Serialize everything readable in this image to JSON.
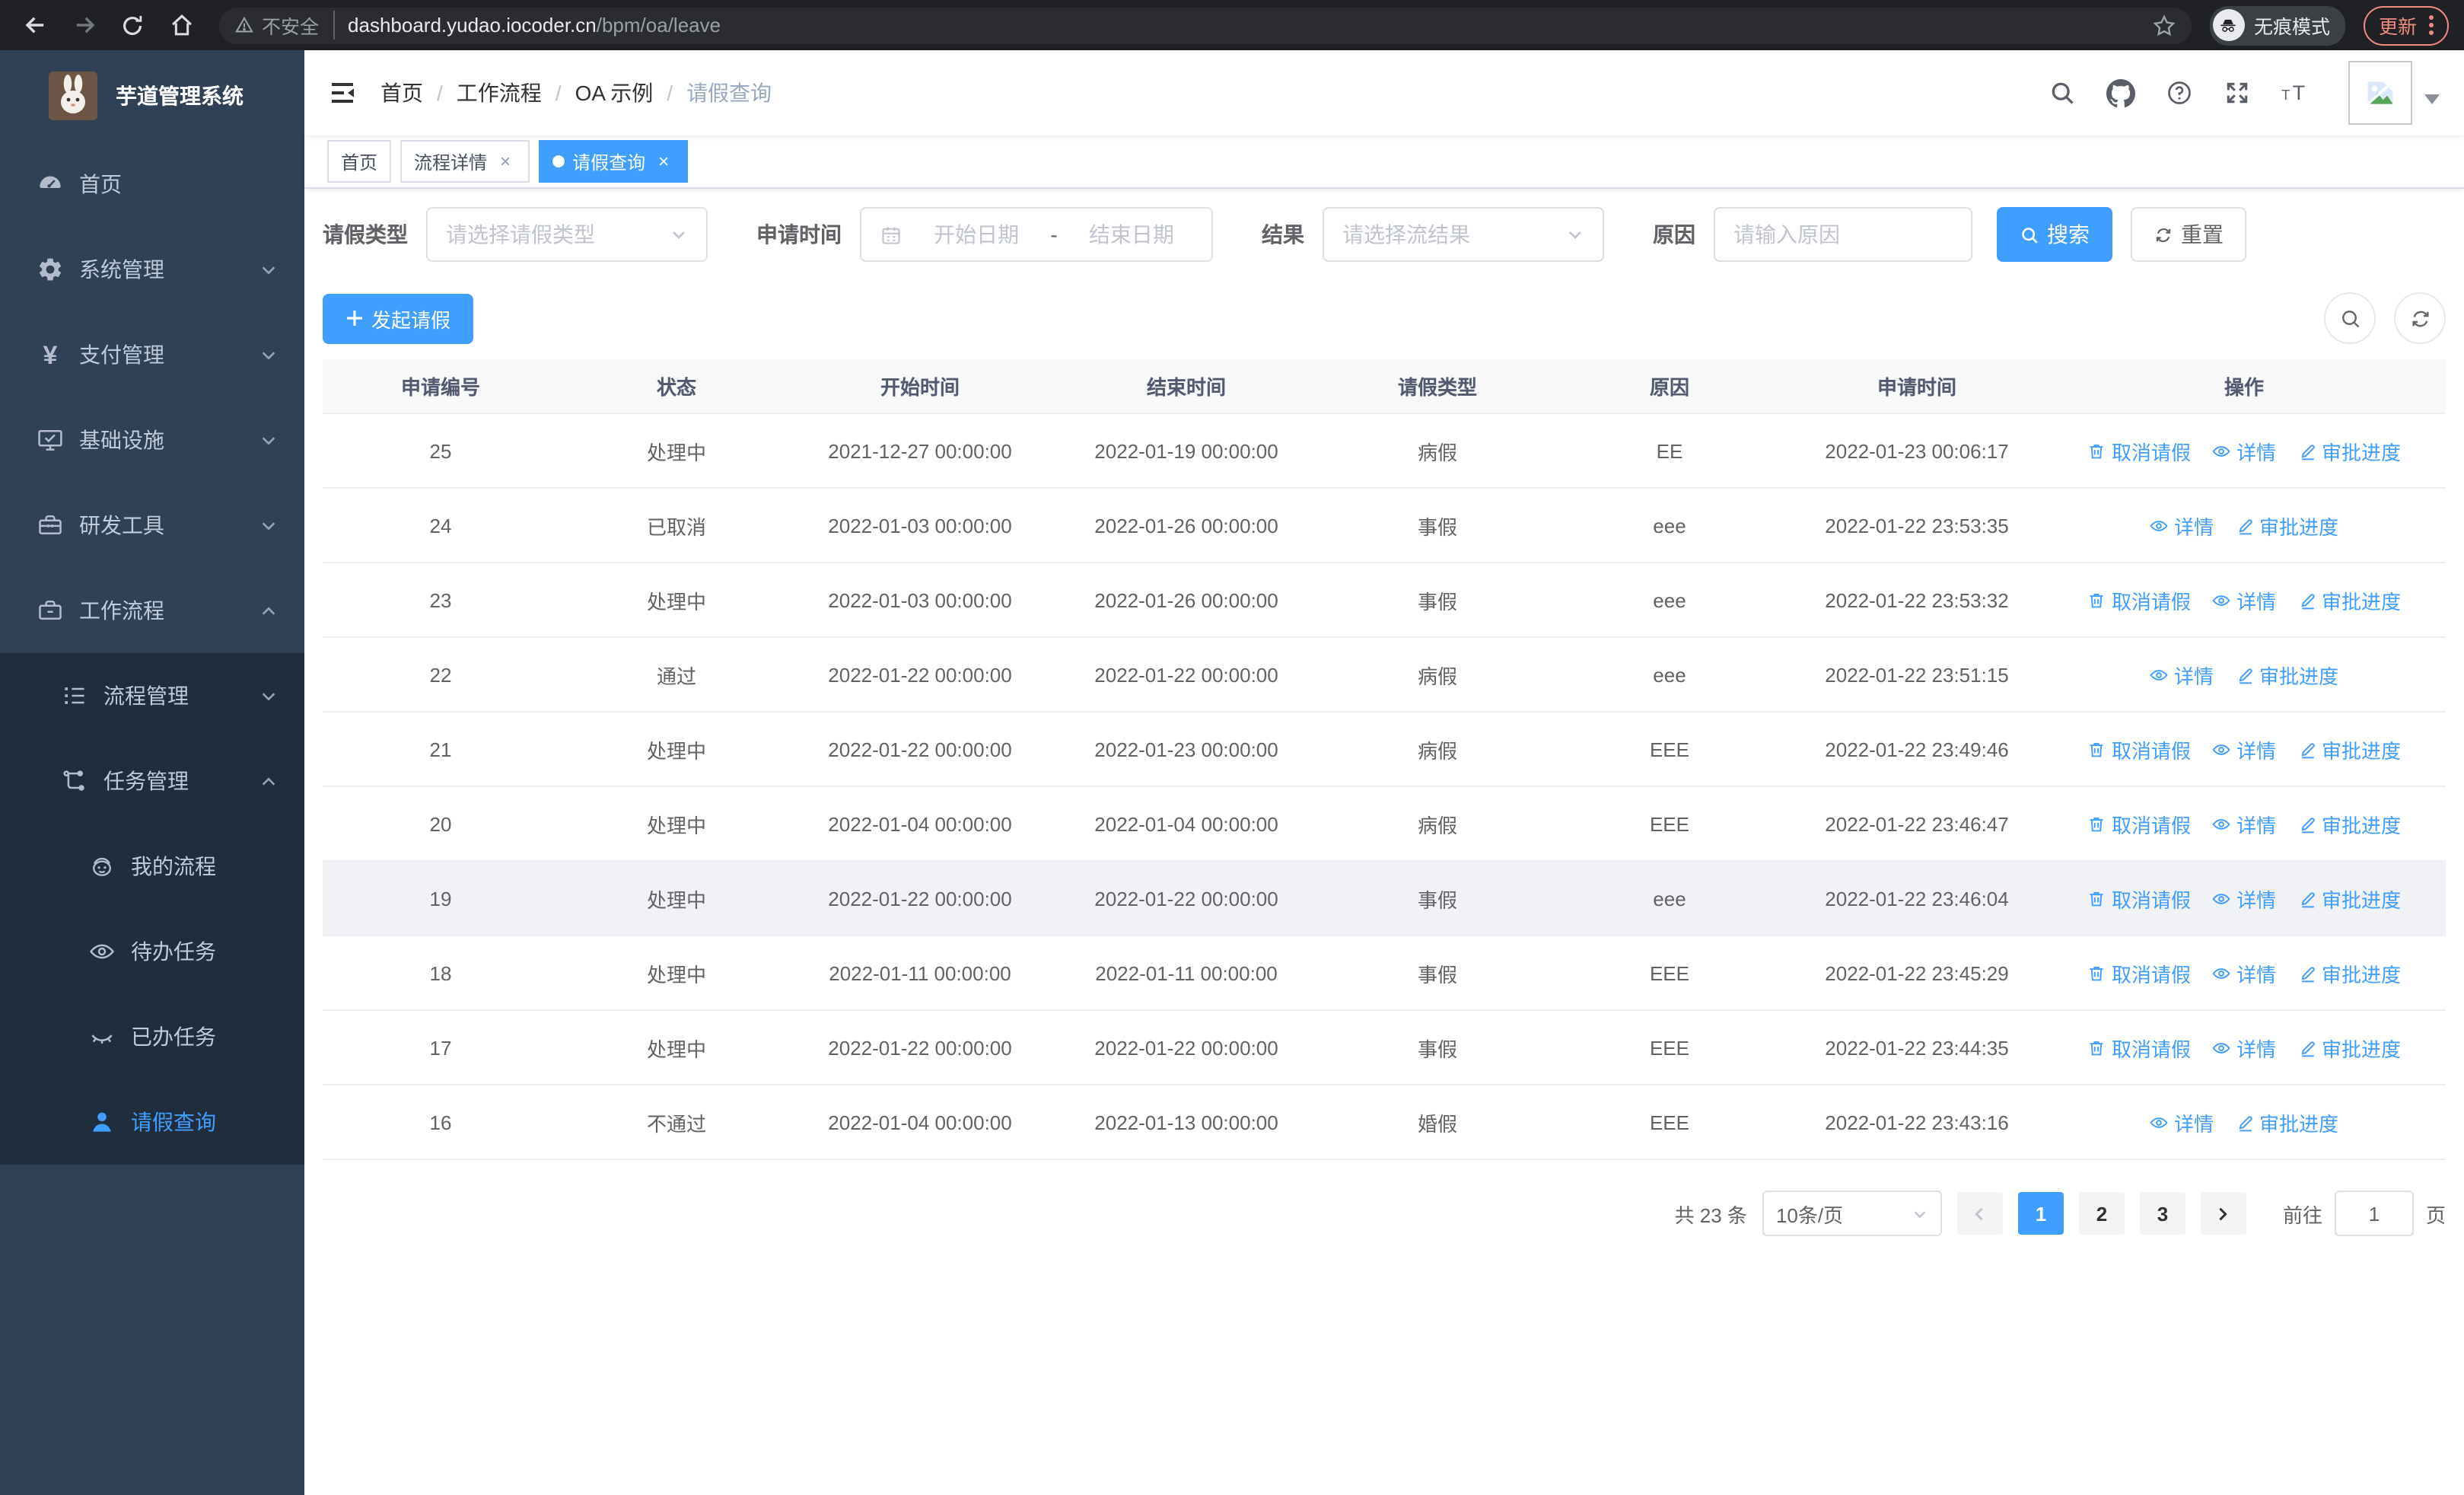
{
  "browser": {
    "security_label": "不安全",
    "url_domain": "dashboard.yudao.iocoder.cn",
    "url_path": "/bpm/oa/leave",
    "incognito_label": "无痕模式",
    "update_label": "更新"
  },
  "sidebar": {
    "title": "芋道管理系统",
    "menu": [
      {
        "label": "首页"
      },
      {
        "label": "系统管理"
      },
      {
        "label": "支付管理"
      },
      {
        "label": "基础设施"
      },
      {
        "label": "研发工具"
      },
      {
        "label": "工作流程"
      }
    ],
    "submenu": [
      {
        "label": "流程管理"
      },
      {
        "label": "任务管理"
      }
    ],
    "task_children": [
      {
        "label": "我的流程"
      },
      {
        "label": "待办任务"
      },
      {
        "label": "已办任务"
      },
      {
        "label": "请假查询"
      }
    ]
  },
  "navbar": {
    "breadcrumb": [
      "首页",
      "工作流程",
      "OA 示例",
      "请假查询"
    ]
  },
  "tags": [
    {
      "label": "首页"
    },
    {
      "label": "流程详情"
    },
    {
      "label": "请假查询"
    }
  ],
  "filters": {
    "type_label": "请假类型",
    "type_placeholder": "请选择请假类型",
    "time_label": "申请时间",
    "date_start_placeholder": "开始日期",
    "date_separator": "-",
    "date_end_placeholder": "结束日期",
    "result_label": "结果",
    "result_placeholder": "请选择流结果",
    "reason_label": "原因",
    "reason_placeholder": "请输入原因",
    "search_label": "搜索",
    "reset_label": "重置"
  },
  "toolbar": {
    "create_label": "发起请假"
  },
  "table": {
    "columns": [
      "申请编号",
      "状态",
      "开始时间",
      "结束时间",
      "请假类型",
      "原因",
      "申请时间",
      "操作"
    ],
    "action_labels": {
      "cancel": "取消请假",
      "detail": "详情",
      "progress": "审批进度"
    },
    "rows": [
      {
        "id": "25",
        "status": "处理中",
        "start": "2021-12-27 00:00:00",
        "end": "2022-01-19 00:00:00",
        "type": "病假",
        "reason": "EE",
        "applied": "2022-01-23 00:06:17",
        "actions": [
          "cancel",
          "detail",
          "progress"
        ],
        "highlight": false
      },
      {
        "id": "24",
        "status": "已取消",
        "start": "2022-01-03 00:00:00",
        "end": "2022-01-26 00:00:00",
        "type": "事假",
        "reason": "eee",
        "applied": "2022-01-22 23:53:35",
        "actions": [
          "detail",
          "progress"
        ],
        "highlight": false
      },
      {
        "id": "23",
        "status": "处理中",
        "start": "2022-01-03 00:00:00",
        "end": "2022-01-26 00:00:00",
        "type": "事假",
        "reason": "eee",
        "applied": "2022-01-22 23:53:32",
        "actions": [
          "cancel",
          "detail",
          "progress"
        ],
        "highlight": false
      },
      {
        "id": "22",
        "status": "通过",
        "start": "2022-01-22 00:00:00",
        "end": "2022-01-22 00:00:00",
        "type": "病假",
        "reason": "eee",
        "applied": "2022-01-22 23:51:15",
        "actions": [
          "detail",
          "progress"
        ],
        "highlight": false
      },
      {
        "id": "21",
        "status": "处理中",
        "start": "2022-01-22 00:00:00",
        "end": "2022-01-23 00:00:00",
        "type": "病假",
        "reason": "EEE",
        "applied": "2022-01-22 23:49:46",
        "actions": [
          "cancel",
          "detail",
          "progress"
        ],
        "highlight": false
      },
      {
        "id": "20",
        "status": "处理中",
        "start": "2022-01-04 00:00:00",
        "end": "2022-01-04 00:00:00",
        "type": "病假",
        "reason": "EEE",
        "applied": "2022-01-22 23:46:47",
        "actions": [
          "cancel",
          "detail",
          "progress"
        ],
        "highlight": false
      },
      {
        "id": "19",
        "status": "处理中",
        "start": "2022-01-22 00:00:00",
        "end": "2022-01-22 00:00:00",
        "type": "事假",
        "reason": "eee",
        "applied": "2022-01-22 23:46:04",
        "actions": [
          "cancel",
          "detail",
          "progress"
        ],
        "highlight": true
      },
      {
        "id": "18",
        "status": "处理中",
        "start": "2022-01-11 00:00:00",
        "end": "2022-01-11 00:00:00",
        "type": "事假",
        "reason": "EEE",
        "applied": "2022-01-22 23:45:29",
        "actions": [
          "cancel",
          "detail",
          "progress"
        ],
        "highlight": false
      },
      {
        "id": "17",
        "status": "处理中",
        "start": "2022-01-22 00:00:00",
        "end": "2022-01-22 00:00:00",
        "type": "事假",
        "reason": "EEE",
        "applied": "2022-01-22 23:44:35",
        "actions": [
          "cancel",
          "detail",
          "progress"
        ],
        "highlight": false
      },
      {
        "id": "16",
        "status": "不通过",
        "start": "2022-01-04 00:00:00",
        "end": "2022-01-13 00:00:00",
        "type": "婚假",
        "reason": "EEE",
        "applied": "2022-01-22 23:43:16",
        "actions": [
          "detail",
          "progress"
        ],
        "highlight": false
      }
    ]
  },
  "pagination": {
    "total_label": "共 23 条",
    "page_size": "10条/页",
    "pages": [
      "1",
      "2",
      "3"
    ],
    "active_page": "1",
    "goto_label": "前往",
    "goto_value": "1",
    "page_unit": "页"
  },
  "colors": {
    "primary": "#409eff",
    "sidebar_bg": "#304156",
    "submenu_bg": "#1f2d3d"
  }
}
